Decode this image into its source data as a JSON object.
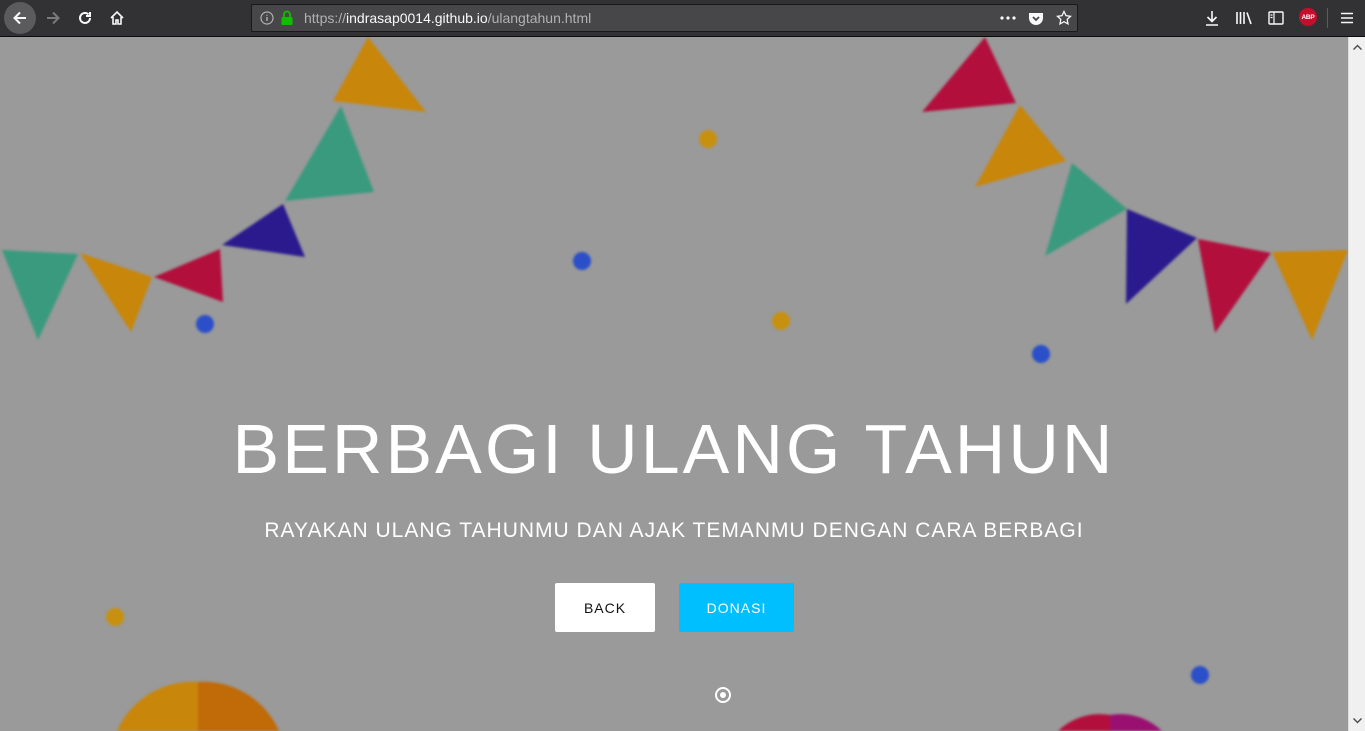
{
  "browser": {
    "url_prefix": "https://",
    "url_host": "indrasap0014.github.io",
    "url_path": "/ulangtahun.html",
    "abp_label": "ABP"
  },
  "hero": {
    "title": "BERBAGI ULANG TAHUN",
    "subtitle": "RAYAKAN ULANG TAHUNMU DAN AJAK TEMANMU DENGAN CARA BERBAGI",
    "back_label": "BACK",
    "donasi_label": "DONASI"
  },
  "colors": {
    "accent": "#00bfff",
    "bunting_teal": "#3a9a7e",
    "bunting_orange": "#c8860a",
    "bunting_navy": "#2a1a8e",
    "bunting_red": "#b20f3c",
    "confetti_blue": "#2a4fc9",
    "confetti_gold": "#c8900f"
  }
}
